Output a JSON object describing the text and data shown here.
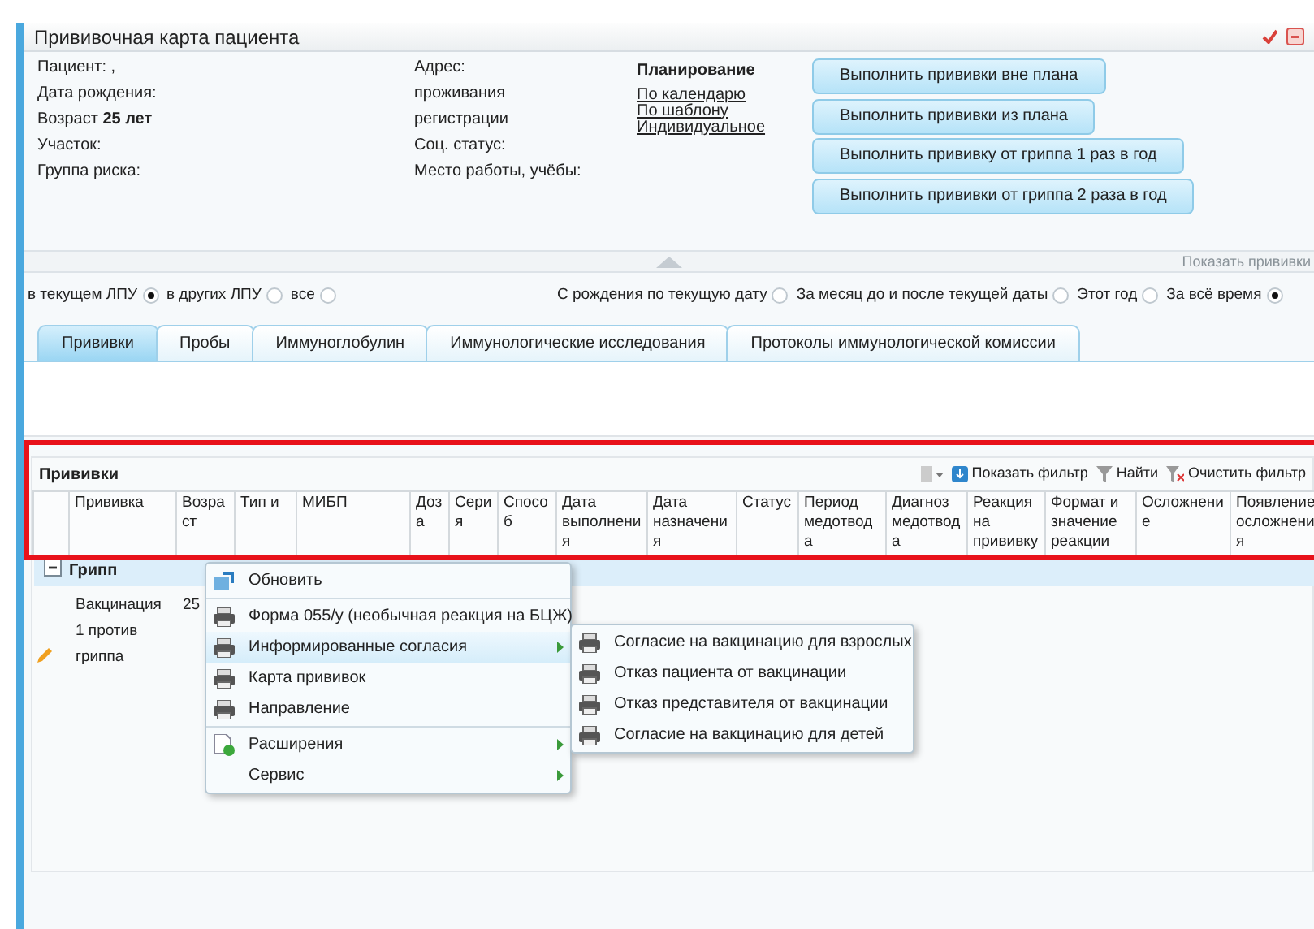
{
  "window": {
    "title": "Прививочная карта пациента"
  },
  "patient_info": {
    "left": [
      "Пациент: ,",
      "Дата рождения:",
      "Возраст **25 лет**",
      "Участок:",
      "Группа риска:"
    ],
    "middle": [
      "Адрес:",
      "проживания",
      "регистрации",
      "Соц. статус:",
      "Место работы, учёбы:"
    ]
  },
  "planning": {
    "title": "Планирование",
    "links": [
      "По календарю",
      "По шаблону",
      "Индивидуальное"
    ]
  },
  "action_buttons": [
    "Выполнить прививки вне плана",
    "Выполнить прививки из плана",
    "Выполнить прививку от гриппа 1 раз в год",
    "Выполнить прививки от гриппа 2 раза в год"
  ],
  "show_link": "Показать прививки",
  "lpu_filter": [
    {
      "label": "в текущем ЛПУ",
      "selected": true
    },
    {
      "label": "в других ЛПУ",
      "selected": false
    },
    {
      "label": "все",
      "selected": false
    }
  ],
  "period_filter": [
    {
      "label": "С рождения по текущую дату",
      "selected": false
    },
    {
      "label": "За месяц до и после текущей даты",
      "selected": false
    },
    {
      "label": "Этот год",
      "selected": false
    },
    {
      "label": "За всё время",
      "selected": true
    }
  ],
  "tabs": [
    {
      "label": "Прививки",
      "selected": true
    },
    {
      "label": "Пробы",
      "selected": false
    },
    {
      "label": "Иммуноглобулин",
      "selected": false
    },
    {
      "label": "Иммунологические исследования",
      "selected": false
    },
    {
      "label": "Протоколы иммунологической комиссии",
      "selected": false
    }
  ],
  "grid": {
    "title": "Прививки",
    "toolbar": [
      "Показать фильтр",
      "Найти",
      "Очистить фильтр"
    ],
    "columns": [
      "Прививка",
      "Возраст",
      "Тип и",
      "МИБП",
      "Доза",
      "Серия",
      "Способ",
      "Дата выполнения",
      "Дата назначения",
      "Статус",
      "Период медотвода",
      "Диагноз медотвода",
      "Реакция на прививку",
      "Формат и значение реакции",
      "Осложнение",
      "Появление осложнения"
    ],
    "groups": [
      {
        "name": "Грипп",
        "expanded": true,
        "rows": [
          {
            "cells": [
              "Вакцинация 1 против гриппа",
              "25"
            ]
          }
        ]
      }
    ]
  },
  "context_menu": {
    "items": [
      {
        "kind": "refresh",
        "label": "Обновить",
        "submenu": false,
        "highlighted": false
      },
      {
        "kind": "separator"
      },
      {
        "kind": "print",
        "label": "Форма 055/у (необычная реакция на БЦЖ)",
        "submenu": false,
        "highlighted": false
      },
      {
        "kind": "print",
        "label": "Информированные согласия",
        "submenu": true,
        "highlighted": true
      },
      {
        "kind": "print",
        "label": "Карта прививок",
        "submenu": false,
        "highlighted": false
      },
      {
        "kind": "print",
        "label": "Направление",
        "submenu": false,
        "highlighted": false
      },
      {
        "kind": "separator"
      },
      {
        "kind": "extension",
        "label": "Расширения",
        "submenu": true,
        "highlighted": false
      },
      {
        "kind": "plain",
        "label": "Сервис",
        "submenu": true,
        "highlighted": false
      }
    ],
    "submenu": [
      "Согласие на вакцинацию для взрослых",
      "Отказ пациента от вакцинации",
      "Отказ представителя от вакцинации",
      "Согласие на вакцинацию для детей"
    ]
  }
}
